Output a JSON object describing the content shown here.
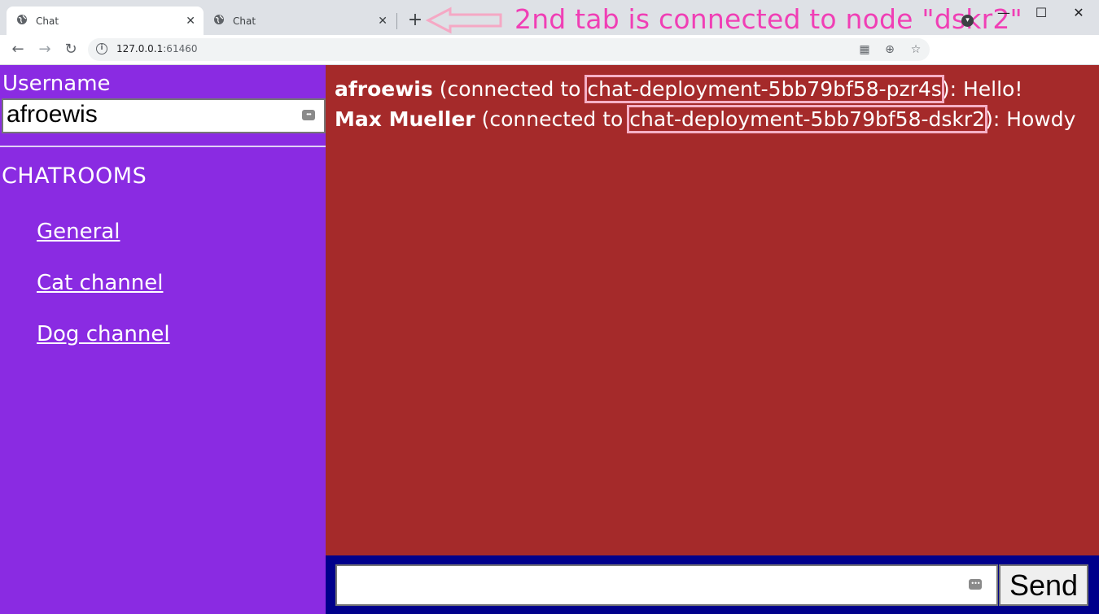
{
  "browser": {
    "tabs": [
      {
        "title": "Chat",
        "active": true
      },
      {
        "title": "Chat",
        "active": false
      }
    ],
    "new_tab_label": "+",
    "url_host": "127.0.0.1",
    "url_port": ":61460",
    "annotation": "2nd tab is connected to node \"dskr2\""
  },
  "sidebar": {
    "username_label": "Username",
    "username_value": "afroewis",
    "chatrooms_title": "CHATROOMS",
    "rooms": [
      {
        "label": "General"
      },
      {
        "label": "Cat channel"
      },
      {
        "label": "Dog channel"
      }
    ]
  },
  "messages": [
    {
      "user": "afroewis",
      "connected_prefix": " (connected to ",
      "node": "chat-deployment-5bb79bf58-pzr4s",
      "suffix": "): Hello!"
    },
    {
      "user": "Max Mueller",
      "connected_prefix": " (connected to ",
      "node": "chat-deployment-5bb79bf58-dskr2",
      "suffix": "): Howdy"
    }
  ],
  "composer": {
    "message_value": "",
    "send_label": "Send"
  },
  "colors": {
    "sidebar_bg": "#8a2be2",
    "messages_bg": "#a52a2a",
    "composer_bg": "#00008b",
    "annotation": "#f03fb5",
    "highlight_box": "#f5b0c6"
  },
  "icons": {
    "tab_favicon": "globe-icon",
    "tab_close": "close-icon",
    "back": "arrow-left-icon",
    "forward": "arrow-right-icon",
    "reload": "reload-icon",
    "site_info": "info-icon",
    "qr": "qr-code-icon",
    "zoom": "zoom-icon",
    "bookmark": "star-icon",
    "input_autofill": "autofill-icon"
  }
}
